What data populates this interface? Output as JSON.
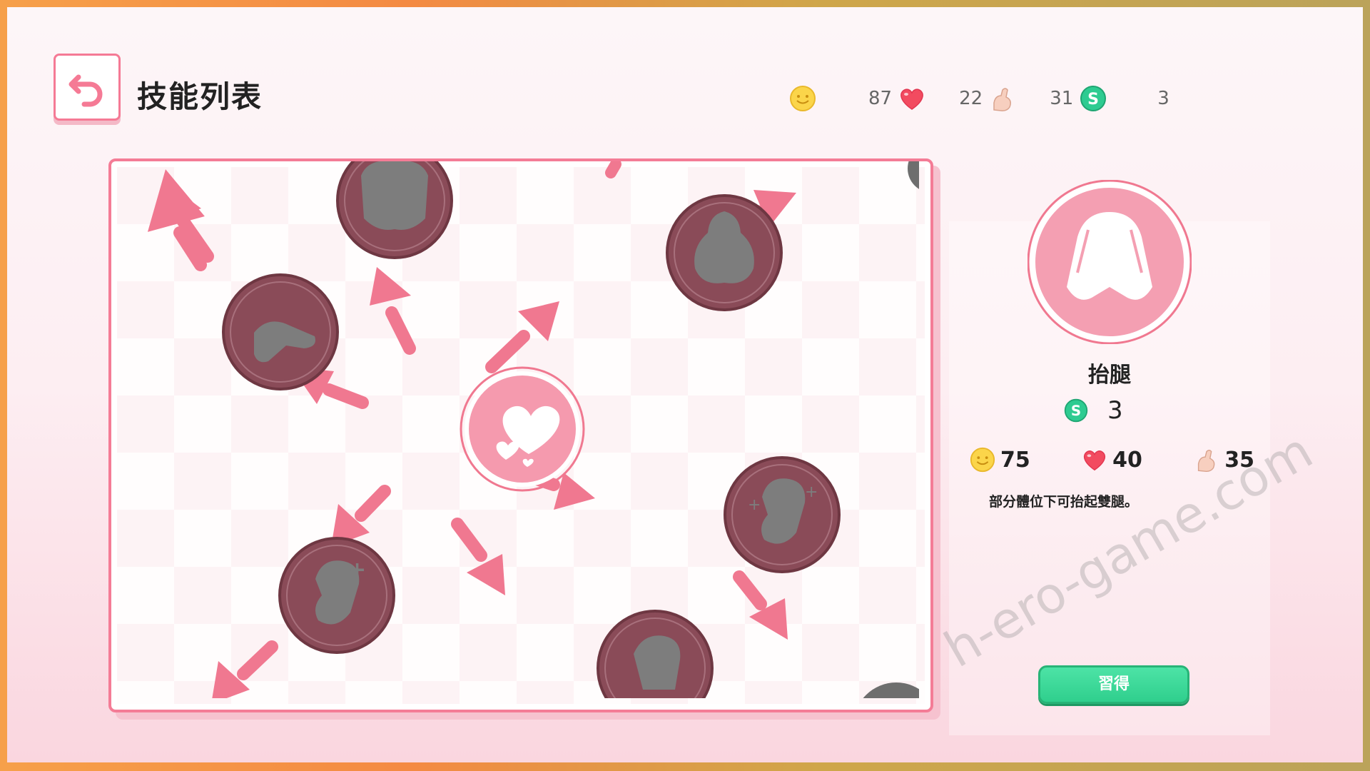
{
  "header": {
    "title": "技能列表"
  },
  "stats": [
    {
      "icon": "smile-coin-icon",
      "value": ""
    },
    {
      "icon": "heart-icon",
      "value": "87"
    },
    {
      "icon": "arm-icon",
      "value": "22"
    },
    {
      "icon": "sp-coin-icon",
      "value": "31"
    },
    {
      "icon": "",
      "value": "3"
    }
  ],
  "detail": {
    "skill_name": "抬腿",
    "sp_cost": "3",
    "requirements": [
      {
        "icon": "smile-coin-icon",
        "value": "75"
      },
      {
        "icon": "heart-icon",
        "value": "40"
      },
      {
        "icon": "arm-icon",
        "value": "35"
      }
    ],
    "description": "部分體位下可抬起雙腿。",
    "learn_label": "習得"
  },
  "watermark": "h-ero-game.com",
  "colors": {
    "accent": "#f47c96",
    "node": "#8a4b58",
    "node_glyph": "#7d7d7d",
    "learn": "#35d393",
    "sp": "#2ecb91"
  }
}
